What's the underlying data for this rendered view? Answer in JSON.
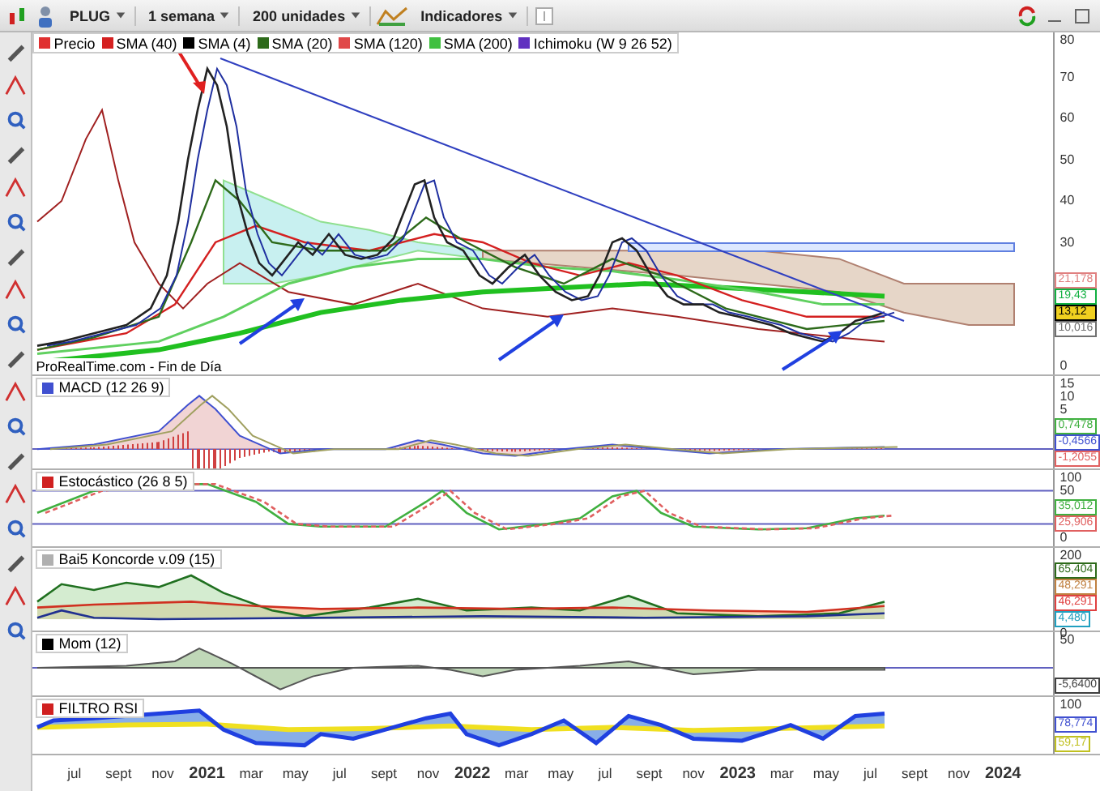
{
  "toolbar": {
    "symbol": "PLUG",
    "period": "1 semana",
    "units": "200 unidades",
    "indicators": "Indicadores"
  },
  "legend": [
    {
      "label": "Precio",
      "color": "#e03030"
    },
    {
      "label": "SMA (40)",
      "color": "#d42020"
    },
    {
      "label": "SMA (4)",
      "color": "#000000"
    },
    {
      "label": "SMA (20)",
      "color": "#2d6a1a"
    },
    {
      "label": "SMA (120)",
      "color": "#e04848"
    },
    {
      "label": "SMA (200)",
      "color": "#40c040"
    },
    {
      "label": "Ichimoku (W 9 26 52)",
      "color": "#6030c0"
    }
  ],
  "panels": [
    {
      "kind": "price",
      "title": "ProRealTime.com - Fin de Día",
      "axis": [
        "80",
        "70",
        "60",
        "50",
        "40",
        "30",
        "0"
      ],
      "tags": [
        {
          "text": "21,178",
          "color": "#e08080",
          "kind": "outline"
        },
        {
          "text": "19,43",
          "color": "#10b040",
          "kind": "outline"
        },
        {
          "text": "13,12",
          "color": "#000000",
          "kind": "highlight"
        },
        {
          "text": "10,016",
          "color": "#707070",
          "kind": "outline"
        }
      ]
    },
    {
      "kind": "macd",
      "title": "MACD (12 26 9)",
      "color": "#4050d0",
      "axis": [
        "15",
        "10",
        "5"
      ],
      "tags": [
        {
          "text": "0,7478",
          "color": "#40b040",
          "kind": "outline"
        },
        {
          "text": "-0,4566",
          "color": "#4050d0",
          "kind": "outline"
        },
        {
          "text": "-1,2055",
          "color": "#e06060",
          "kind": "outline"
        }
      ]
    },
    {
      "kind": "stoch",
      "title": "Estocástico (26 8 5)",
      "color": "#d02020",
      "axis": [
        "100",
        "50",
        "0"
      ],
      "tags": [
        {
          "text": "35,012",
          "color": "#40b040",
          "kind": "outline"
        },
        {
          "text": "25,906",
          "color": "#e06060",
          "kind": "outline"
        }
      ]
    },
    {
      "kind": "koncorde",
      "title": "Bai5 Koncorde v.09 (15)",
      "color": "#b0b0b0",
      "axis": [
        "200",
        "0"
      ],
      "tags": [
        {
          "text": "65,404",
          "color": "#2d6a1a",
          "kind": "outline"
        },
        {
          "text": "48,291",
          "color": "#c08040",
          "kind": "outline"
        },
        {
          "text": "46,291",
          "color": "#e04040",
          "kind": "outline"
        },
        {
          "text": "4,480",
          "color": "#20a0c0",
          "kind": "outline"
        }
      ]
    },
    {
      "kind": "mom",
      "title": "Mom (12)",
      "color": "#000000",
      "axis": [
        "50"
      ],
      "tags": [
        {
          "text": "-5,6400",
          "color": "#404040",
          "kind": "outline"
        }
      ]
    },
    {
      "kind": "rsi",
      "title": "FILTRO RSI",
      "color": "#d02020",
      "axis": [
        "100"
      ],
      "tags": [
        {
          "text": "78,774",
          "color": "#4050d0",
          "kind": "outline"
        },
        {
          "text": "59,17",
          "color": "#c0c020",
          "kind": "outline"
        }
      ]
    }
  ],
  "xaxis": [
    {
      "label": "jul",
      "kind": "month"
    },
    {
      "label": "sept",
      "kind": "month"
    },
    {
      "label": "nov",
      "kind": "month"
    },
    {
      "label": "2021",
      "kind": "year"
    },
    {
      "label": "mar",
      "kind": "month"
    },
    {
      "label": "may",
      "kind": "month"
    },
    {
      "label": "jul",
      "kind": "month"
    },
    {
      "label": "sept",
      "kind": "month"
    },
    {
      "label": "nov",
      "kind": "month"
    },
    {
      "label": "2022",
      "kind": "year"
    },
    {
      "label": "mar",
      "kind": "month"
    },
    {
      "label": "may",
      "kind": "month"
    },
    {
      "label": "jul",
      "kind": "month"
    },
    {
      "label": "sept",
      "kind": "month"
    },
    {
      "label": "nov",
      "kind": "month"
    },
    {
      "label": "2023",
      "kind": "year"
    },
    {
      "label": "mar",
      "kind": "month"
    },
    {
      "label": "may",
      "kind": "month"
    },
    {
      "label": "jul",
      "kind": "month"
    },
    {
      "label": "sept",
      "kind": "month"
    },
    {
      "label": "nov",
      "kind": "month"
    },
    {
      "label": "2024",
      "kind": "year"
    }
  ]
}
